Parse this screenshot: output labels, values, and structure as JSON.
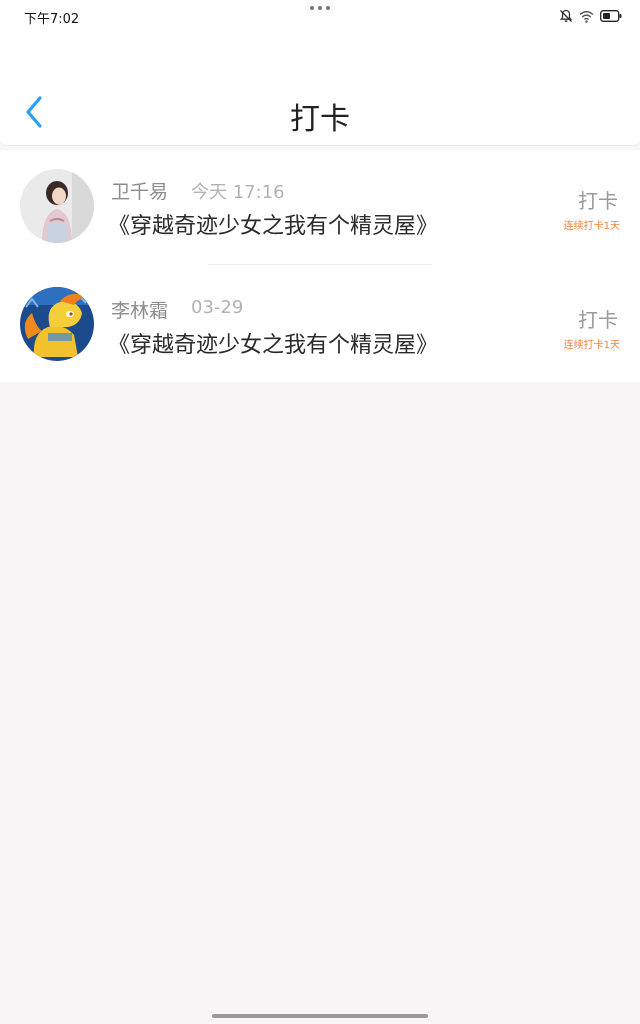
{
  "status_bar": {
    "time": "下午7:02"
  },
  "header": {
    "title": "打卡"
  },
  "checkins": [
    {
      "user": "卫千易",
      "time": "今天 17:16",
      "book": "《穿越奇迹少女之我有个精灵屋》",
      "action": "打卡",
      "streak": "连续打卡1天"
    },
    {
      "user": "李林霜",
      "time": "03-29",
      "book": "《穿越奇迹少女之我有个精灵屋》",
      "action": "打卡",
      "streak": "连续打卡1天"
    }
  ],
  "colors": {
    "accent_blue": "#2a9df4",
    "streak_orange": "#f07f3a",
    "page_background": "#f8f6f7"
  }
}
